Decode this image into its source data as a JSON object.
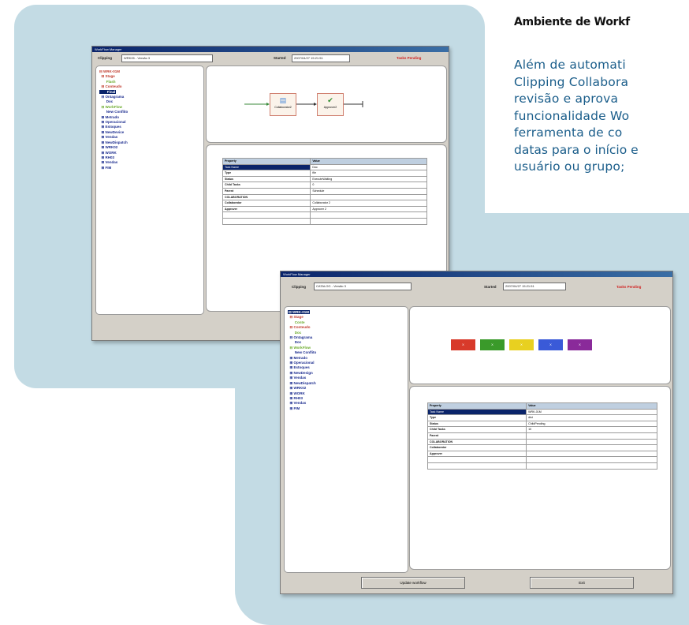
{
  "article": {
    "title": "Ambiente de Workf",
    "lines": [
      "Além de automati",
      "Clipping Collabora",
      "revisão e aprova",
      "funcionalidade Wo",
      "ferramenta de co",
      "datas para o início e",
      "usuário ou grupo;"
    ]
  },
  "window_back": {
    "title": "WorkFlow Manager",
    "clipping_label": "Clipping",
    "clipping_value": "WRK05 - Versão 3",
    "started_label": "Started",
    "started_value": "2007/04/27 15:21:51",
    "status": "Tasks Pending",
    "tree_items": [
      {
        "text": "⊟ WRK-01M",
        "color": "#c0392b"
      },
      {
        "text": "  ⊟ Stage",
        "color": "#c0392b"
      },
      {
        "text": "       Flash",
        "color": "#6aaa2a"
      },
      {
        "text": "  ⊟ Conteudo",
        "color": "#c0392b"
      },
      {
        "text": "       Final",
        "color": "#ffffff",
        "selected": true
      },
      {
        "text": "  ⊟ Ontagrama",
        "color": "#1a2b8e"
      },
      {
        "text": "       Doc",
        "color": "#1a2b8e"
      },
      {
        "text": "  ⊟ WorkFlow",
        "color": "#6aaa2a"
      },
      {
        "text": "       New Conflito",
        "color": "#1a2b8e"
      },
      {
        "text": "  ⊞ Metrado",
        "color": "#1a2b8e"
      },
      {
        "text": "  ⊞ Operacional",
        "color": "#1a2b8e"
      },
      {
        "text": "  ⊞ Estoques",
        "color": "#1a2b8e"
      },
      {
        "text": "  ⊞ NewDevice",
        "color": "#1a2b8e"
      },
      {
        "text": "  ⊞ Vendas",
        "color": "#1a2b8e"
      },
      {
        "text": "  ⊞ NewDispatch",
        "color": "#1a2b8e"
      },
      {
        "text": "  ⊞ WRK02",
        "color": "#1a2b8e"
      },
      {
        "text": "  ⊞ WORK",
        "color": "#1a2b8e"
      },
      {
        "text": "  ⊞ RH03",
        "color": "#1a2b8e"
      },
      {
        "text": "  ⊞ Vendas",
        "color": "#1a2b8e"
      },
      {
        "text": "  ⊞ FIM",
        "color": "#1a2b8e"
      }
    ],
    "nodes": [
      {
        "label": "Collaborator2",
        "icon": "▤",
        "icon_color": "#4a8ad8"
      },
      {
        "label": "Approver2",
        "icon": "✔",
        "icon_color": "#2a8a2a"
      }
    ],
    "table_headers": [
      "Property",
      "Value"
    ],
    "table_rows": [
      {
        "prop": "Task Name",
        "value": "Doc",
        "selected": true
      },
      {
        "prop": "Type",
        "value": "file"
      },
      {
        "prop": "Status",
        "value": "ExecuteWaiting"
      },
      {
        "prop": "Child Tasks",
        "value": "0"
      },
      {
        "prop": "Parent",
        "value": "Schedule"
      },
      {
        "prop": "COLABORATION",
        "value": ""
      },
      {
        "prop": "Collaborator",
        "value": "Collaborator 2"
      },
      {
        "prop": "Approver",
        "value": "Approver 2"
      },
      {
        "prop": "",
        "value": ""
      },
      {
        "prop": "",
        "value": ""
      }
    ]
  },
  "window_front": {
    "title": "WorkFlow Manager",
    "clipping_label": "Clipping",
    "clipping_value": "CATALOG - Versão 3",
    "started_label": "Started",
    "started_value": "2007/04/27 15:21:51",
    "status": "Tasks Pending",
    "tree_items": [
      {
        "text": "⊟ WRK-01M",
        "color": "#ffffff",
        "selected": true
      },
      {
        "text": "  ⊟ Stage",
        "color": "#c0392b"
      },
      {
        "text": "       Conte",
        "color": "#6aaa2a"
      },
      {
        "text": "  ⊟ Conteudo",
        "color": "#c0392b"
      },
      {
        "text": "       Doc",
        "color": "#6aaa2a"
      },
      {
        "text": "  ⊟ Ontagrama",
        "color": "#1a2b8e"
      },
      {
        "text": "       Doc",
        "color": "#1a2b8e"
      },
      {
        "text": "  ⊟ WorkFlow",
        "color": "#6aaa2a"
      },
      {
        "text": "       New Conflito",
        "color": "#1a2b8e"
      },
      {
        "text": "  ⊞ Metrado",
        "color": "#1a2b8e"
      },
      {
        "text": "  ⊞ Operacional",
        "color": "#1a2b8e"
      },
      {
        "text": "  ⊞ Estoques",
        "color": "#1a2b8e"
      },
      {
        "text": "  ⊞ NewDesign",
        "color": "#1a2b8e"
      },
      {
        "text": "  ⊞ Vendas",
        "color": "#1a2b8e"
      },
      {
        "text": "  ⊞ NewDispatch",
        "color": "#1a2b8e"
      },
      {
        "text": "  ⊞ WRK02",
        "color": "#1a2b8e"
      },
      {
        "text": "  ⊞ WORK",
        "color": "#1a2b8e"
      },
      {
        "text": "  ⊞ RH03",
        "color": "#1a2b8e"
      },
      {
        "text": "  ⊞ Vendas",
        "color": "#1a2b8e"
      },
      {
        "text": "  ⊞ FIM",
        "color": "#1a2b8e"
      }
    ],
    "color_boxes": [
      {
        "label": "X",
        "color": "#d83a2a"
      },
      {
        "label": "X",
        "color": "#3a9a2a"
      },
      {
        "label": "X",
        "color": "#e8d020"
      },
      {
        "label": "X",
        "color": "#3a5ad8"
      },
      {
        "label": "X",
        "color": "#8a2a9a"
      }
    ],
    "table_headers": [
      "Property",
      "Value"
    ],
    "table_rows": [
      {
        "prop": "Task Name",
        "value": "WRK-01M",
        "selected": true
      },
      {
        "prop": "Type",
        "value": "dist"
      },
      {
        "prop": "Status",
        "value": "ChildPending"
      },
      {
        "prop": "Child Tasks",
        "value": "10"
      },
      {
        "prop": "Parent",
        "value": ""
      },
      {
        "prop": "COLABORATION",
        "value": ""
      },
      {
        "prop": "Collaborator",
        "value": ""
      },
      {
        "prop": "Approver",
        "value": ""
      },
      {
        "prop": "",
        "value": ""
      },
      {
        "prop": "",
        "value": ""
      }
    ],
    "button_left": "Update workflow",
    "button_right": "Exit"
  }
}
